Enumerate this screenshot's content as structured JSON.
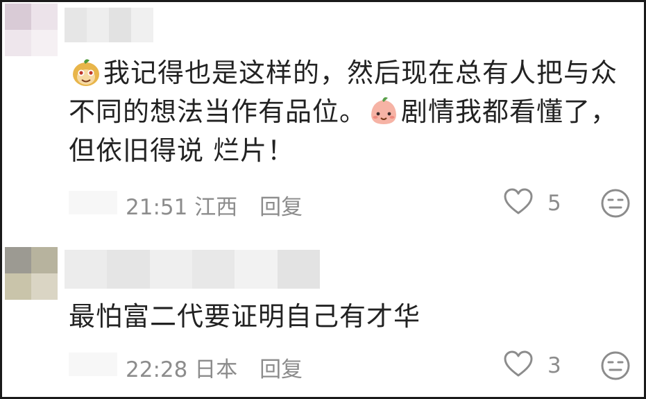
{
  "comments": [
    {
      "text_parts": [
        "我记得也是这样的，然后现在总有人把与众不同的想法当作有品位。",
        "剧情我都看懂了，但依旧得说 烂片！"
      ],
      "emojis": [
        "monkey-face-emoji",
        "peach-face-emoji"
      ],
      "time": "21:51",
      "location": "江西",
      "reply_label": "回复",
      "likes": "5"
    },
    {
      "text": "最怕富二代要证明自己有才华",
      "time": "22:28",
      "location": "日本",
      "reply_label": "回复",
      "likes": "3"
    }
  ],
  "icons": {
    "like": "heart-outline-icon",
    "dislike": "neutral-face-icon"
  },
  "colors": {
    "text": "#222222",
    "meta": "#8c8c8c",
    "border": "#1a1a1a"
  }
}
